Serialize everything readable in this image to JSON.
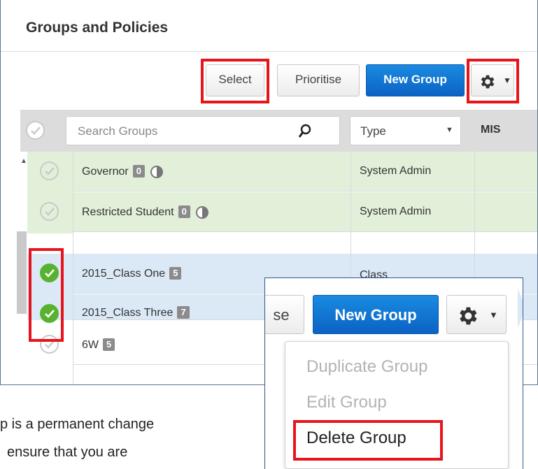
{
  "panel": {
    "title": "Groups and Policies"
  },
  "toolbar": {
    "select_label": "Select",
    "prioritise_label": "Prioritise",
    "new_group_label": "New Group",
    "settings_icon": "gear-icon"
  },
  "table": {
    "search_placeholder": "Search Groups",
    "type_filter": "Type",
    "mis_header": "MIS",
    "rows": [
      {
        "name": "Governor",
        "count": "0",
        "type": "System Admin",
        "selected": false
      },
      {
        "name": "Restricted Student",
        "count": "0",
        "type": "System Admin",
        "selected": false
      },
      {
        "name": "2015_Class One",
        "count": "5",
        "type": "Class",
        "selected": true
      },
      {
        "name": "2015_Class Three",
        "count": "7",
        "type": "",
        "selected": true
      },
      {
        "name": "6W",
        "count": "5",
        "type": "",
        "selected": false
      }
    ]
  },
  "overlay": {
    "partial_button_label": "se",
    "new_group_label": "New Group",
    "menu": {
      "duplicate": "Duplicate Group",
      "edit": "Edit Group",
      "delete": "Delete Group"
    }
  },
  "body_text": {
    "line1": "p is a permanent change",
    "line2": "ensure that you are"
  },
  "colors": {
    "primary": "#0b62c4",
    "highlight": "#e8141c",
    "selected_row": "#dbe9f6",
    "system_row": "#e2f0da",
    "check_on": "#58b230"
  }
}
